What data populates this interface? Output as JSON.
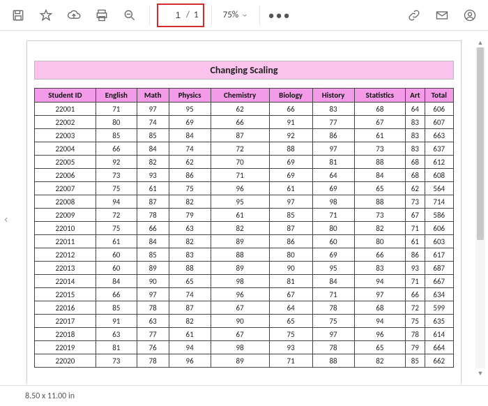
{
  "toolbar": {
    "page_current": "1",
    "page_total": "1",
    "zoom": "75%"
  },
  "document": {
    "title": "Changing Scaling",
    "columns": [
      "Student ID",
      "English",
      "Math",
      "Physics",
      "Chemistry",
      "Biology",
      "History",
      "Statistics",
      "Art",
      "Total"
    ],
    "rows": [
      [
        "22001",
        "71",
        "97",
        "95",
        "62",
        "66",
        "83",
        "68",
        "64",
        "606"
      ],
      [
        "22002",
        "80",
        "74",
        "69",
        "66",
        "91",
        "77",
        "67",
        "83",
        "607"
      ],
      [
        "22003",
        "85",
        "85",
        "84",
        "87",
        "92",
        "86",
        "61",
        "83",
        "663"
      ],
      [
        "22004",
        "66",
        "84",
        "74",
        "72",
        "88",
        "97",
        "73",
        "83",
        "637"
      ],
      [
        "22005",
        "92",
        "82",
        "62",
        "70",
        "69",
        "81",
        "88",
        "68",
        "612"
      ],
      [
        "22006",
        "73",
        "93",
        "86",
        "71",
        "69",
        "64",
        "84",
        "68",
        "608"
      ],
      [
        "22007",
        "75",
        "61",
        "75",
        "96",
        "61",
        "69",
        "65",
        "62",
        "564"
      ],
      [
        "22008",
        "94",
        "87",
        "82",
        "95",
        "97",
        "98",
        "88",
        "73",
        "714"
      ],
      [
        "22009",
        "72",
        "78",
        "79",
        "61",
        "85",
        "71",
        "73",
        "67",
        "586"
      ],
      [
        "22010",
        "75",
        "66",
        "63",
        "82",
        "87",
        "80",
        "82",
        "71",
        "606"
      ],
      [
        "22011",
        "61",
        "84",
        "82",
        "89",
        "86",
        "60",
        "80",
        "61",
        "603"
      ],
      [
        "22012",
        "60",
        "85",
        "83",
        "88",
        "80",
        "69",
        "66",
        "86",
        "617"
      ],
      [
        "22013",
        "60",
        "89",
        "88",
        "89",
        "90",
        "95",
        "83",
        "93",
        "687"
      ],
      [
        "22014",
        "84",
        "90",
        "65",
        "98",
        "81",
        "84",
        "94",
        "71",
        "667"
      ],
      [
        "22015",
        "66",
        "97",
        "74",
        "96",
        "67",
        "71",
        "97",
        "66",
        "634"
      ],
      [
        "22016",
        "85",
        "78",
        "87",
        "67",
        "64",
        "78",
        "68",
        "72",
        "599"
      ],
      [
        "22017",
        "91",
        "63",
        "82",
        "90",
        "65",
        "75",
        "94",
        "75",
        "635"
      ],
      [
        "22018",
        "63",
        "77",
        "61",
        "67",
        "75",
        "97",
        "96",
        "78",
        "614"
      ],
      [
        "22019",
        "81",
        "76",
        "94",
        "98",
        "93",
        "78",
        "65",
        "79",
        "664"
      ],
      [
        "22020",
        "73",
        "78",
        "96",
        "89",
        "71",
        "88",
        "82",
        "85",
        "662"
      ]
    ]
  },
  "status": {
    "page_size": "8.50 x 11.00 in"
  }
}
